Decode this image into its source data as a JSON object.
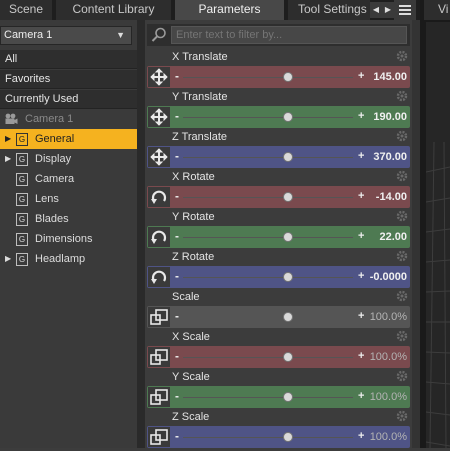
{
  "tabs": {
    "scene": "Scene",
    "content_library": "Content Library",
    "parameters": "Parameters",
    "tool_settings": "Tool Settings",
    "viewport_partial": "Vi"
  },
  "left_panel": {
    "dropdown_value": "Camera 1",
    "filters": [
      "All",
      "Favorites",
      "Currently Used"
    ],
    "node_title": "Camera 1",
    "tree_items": [
      {
        "label": "General",
        "expandable": true,
        "selected": true
      },
      {
        "label": "Display",
        "expandable": true,
        "selected": false
      },
      {
        "label": "Camera",
        "expandable": false,
        "selected": false
      },
      {
        "label": "Lens",
        "expandable": false,
        "selected": false
      },
      {
        "label": "Blades",
        "expandable": false,
        "selected": false
      },
      {
        "label": "Dimensions",
        "expandable": false,
        "selected": false
      },
      {
        "label": "Headlamp",
        "expandable": true,
        "selected": false
      }
    ]
  },
  "search": {
    "placeholder": "Enter text to filter by..."
  },
  "parameters": [
    {
      "name": "X Translate",
      "value": "145.00",
      "icon": "move-icon",
      "color": "#7a4a4e",
      "knob": 0.62
    },
    {
      "name": "Y Translate",
      "value": "190.00",
      "icon": "move-icon",
      "color": "#4e7a52",
      "knob": 0.62
    },
    {
      "name": "Z Translate",
      "value": "370.00",
      "icon": "move-icon",
      "color": "#4f5486",
      "knob": 0.62
    },
    {
      "name": "X Rotate",
      "value": "-14.00",
      "icon": "rotate-icon",
      "color": "#7a4a4e",
      "knob": 0.62
    },
    {
      "name": "Y Rotate",
      "value": "22.00",
      "icon": "rotate-icon",
      "color": "#4e7a52",
      "knob": 0.62
    },
    {
      "name": "Z Rotate",
      "value": "-0.0000",
      "icon": "rotate-icon",
      "color": "#4f5486",
      "knob": 0.62
    },
    {
      "name": "Scale",
      "value": "100.0%",
      "icon": "scale-icon",
      "color": "#555555",
      "knob": 0.62
    },
    {
      "name": "X Scale",
      "value": "100.0%",
      "icon": "scale-icon",
      "color": "#7a4a4e",
      "knob": 0.62
    },
    {
      "name": "Y Scale",
      "value": "100.0%",
      "icon": "scale-icon",
      "color": "#4e7a52",
      "knob": 0.62
    },
    {
      "name": "Z Scale",
      "value": "100.0%",
      "icon": "scale-icon",
      "color": "#4f5486",
      "knob": 0.62
    }
  ],
  "slider_minus": "-",
  "slider_plus": "+",
  "colors": {
    "accent_selected": "#f5b21f"
  }
}
